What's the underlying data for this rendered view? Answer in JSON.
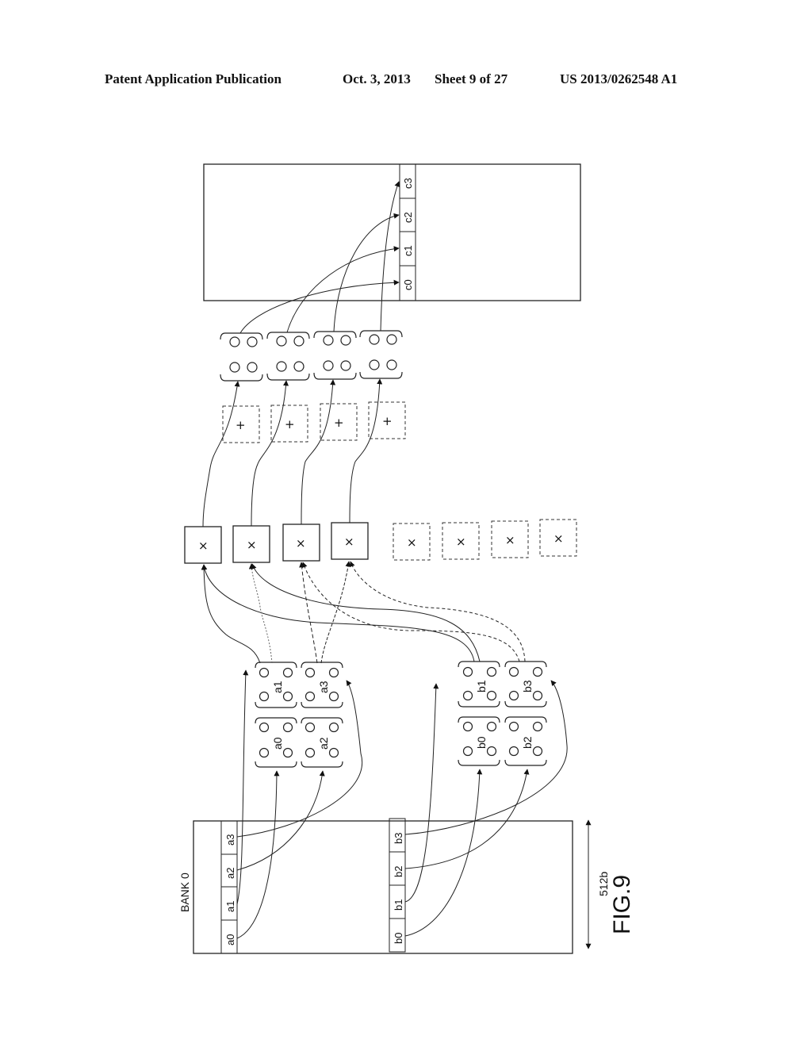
{
  "header": {
    "publication": "Patent Application Publication",
    "date": "Oct. 3, 2013",
    "sheet": "Sheet 9 of 27",
    "number": "US 2013/0262548 A1"
  },
  "figure": {
    "label": "FIG.9",
    "bank_label": "BANK 0",
    "width_label": "512b",
    "bank_a_cells": [
      "a0",
      "a1",
      "a2",
      "a3"
    ],
    "bank_b_cells": [
      "b0",
      "b1",
      "b2",
      "b3"
    ],
    "result_cells": [
      "c0",
      "c1",
      "c2",
      "c3"
    ],
    "register_a_labels": [
      "a0",
      "a1",
      "a2",
      "a3"
    ],
    "register_b_labels": [
      "b0",
      "b1",
      "b2",
      "b3"
    ],
    "multiply_symbol": "×",
    "add_symbol": "+",
    "active_multipliers": 4,
    "inactive_multipliers": 4,
    "adders": 4,
    "output_registers": 4
  }
}
